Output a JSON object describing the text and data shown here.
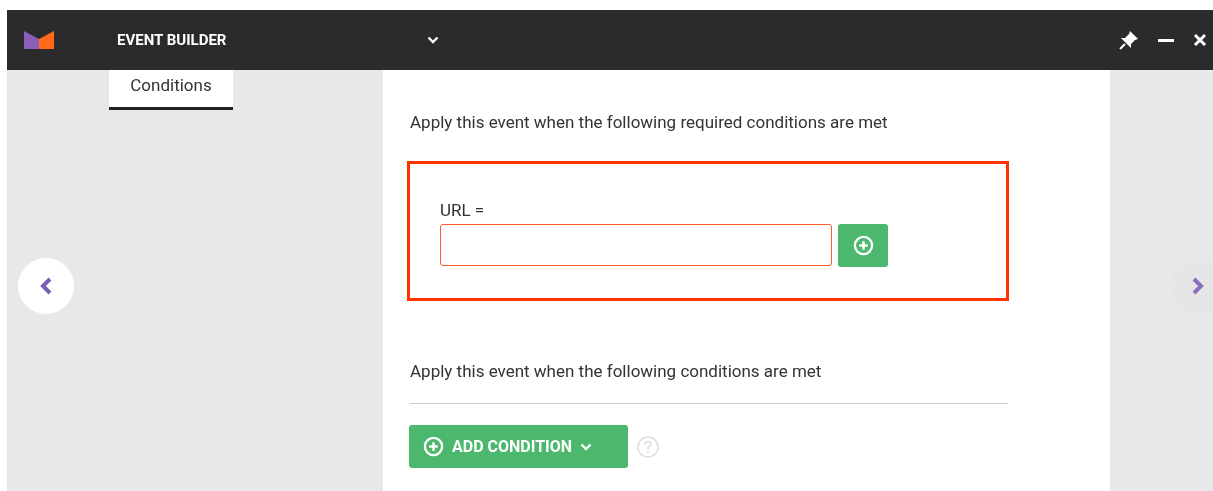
{
  "window": {
    "title": "EVENT BUILDER"
  },
  "tabs": [
    {
      "label": "Conditions",
      "selected": true
    }
  ],
  "required": {
    "heading": "Apply this event when the following required conditions are met",
    "field_label": "URL =",
    "invalid": true
  },
  "optional": {
    "heading": "Apply this event when the following conditions are met",
    "add_button": "ADD CONDITION"
  }
}
